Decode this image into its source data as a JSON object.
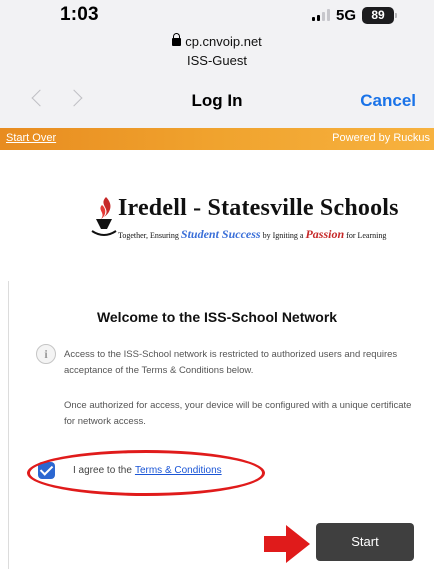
{
  "status_bar": {
    "time": "1:03",
    "network": "5G",
    "battery": "89"
  },
  "browser": {
    "url": "cp.cnvoip.net",
    "ssid": "ISS-Guest",
    "title": "Log In",
    "cancel_label": "Cancel"
  },
  "portal_bar": {
    "start_over": "Start Over",
    "powered_by": "Powered by Ruckus"
  },
  "logo": {
    "name": "Iredell - Statesville Schools",
    "tagline_1": "Together, Ensuring",
    "tagline_2": "Student Success",
    "tagline_3": "by Igniting a",
    "tagline_4": "Passion",
    "tagline_5": "for Learning"
  },
  "card": {
    "title": "Welcome to the ISS-School Network",
    "paragraph_1": "Access to the ISS-School network is restricted to authorized users and requires acceptance of the Terms & Conditions below.",
    "paragraph_2": "Once authorized for access, your device will be configured with a unique certificate for network access.",
    "agree_text": "I agree to the",
    "terms_link": "Terms & Conditions",
    "start_label": "Start"
  },
  "colors": {
    "accent_blue": "#1a73e8",
    "orange": "#f0a32e",
    "annotation_red": "#e01b1b",
    "button_dark": "#3f3f3f"
  }
}
